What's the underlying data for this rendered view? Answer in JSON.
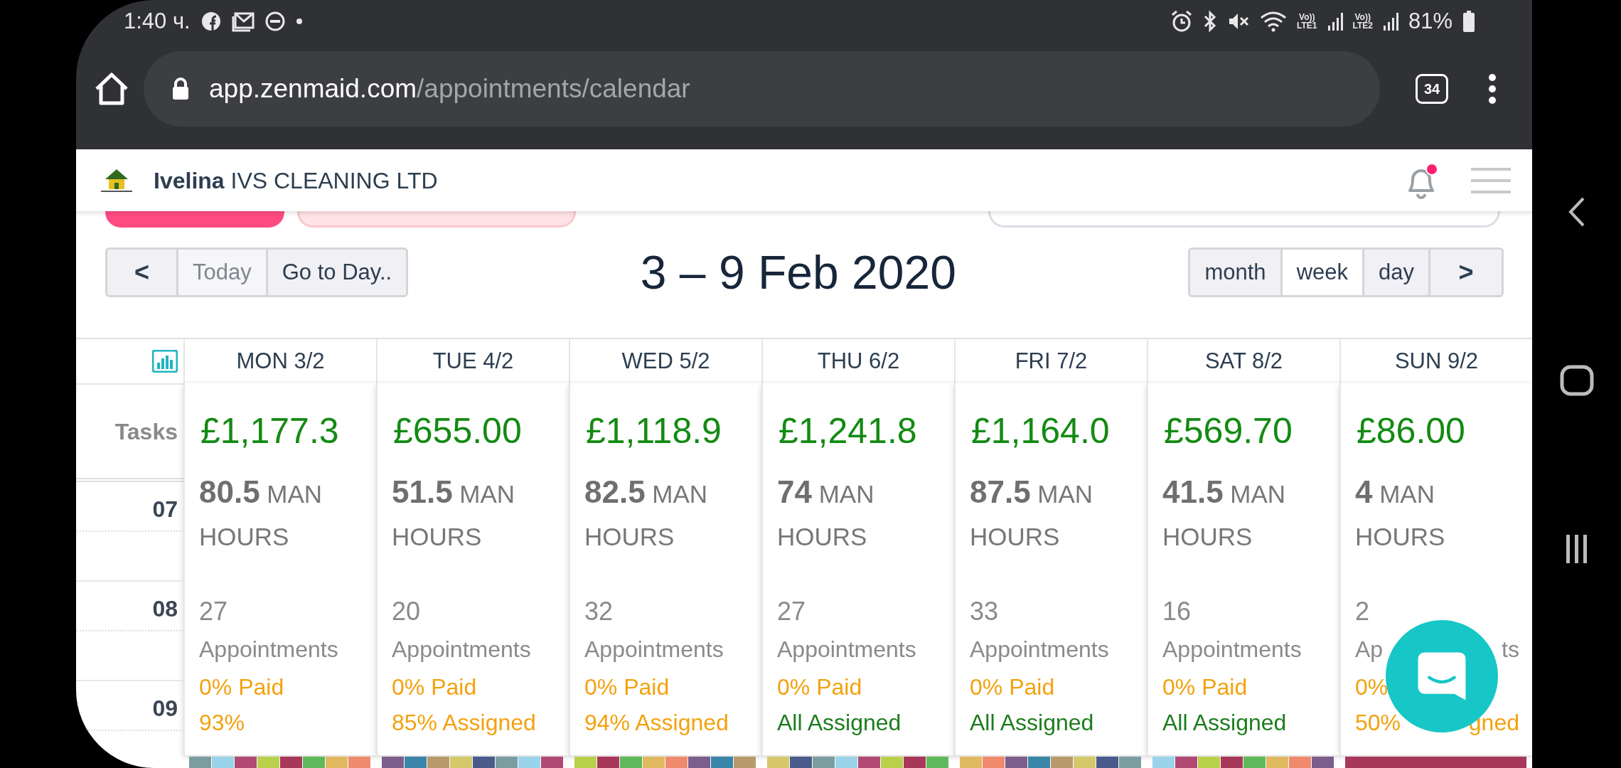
{
  "status_bar": {
    "time": "1:40 ч.",
    "networks": [
      {
        "top": "Vo))",
        "bottom": "LTE1"
      },
      {
        "top": "Vo))",
        "bottom": "LTE2"
      }
    ],
    "battery": "81%"
  },
  "browser": {
    "url_host": "app.zenmaid.com",
    "url_path": "/appointments/calendar",
    "tab_count": "34"
  },
  "app_header": {
    "title": "**Ivelina** IVS CLEANING LTD",
    "notification": true
  },
  "toolbar": {
    "nav_buttons": [
      {
        "label": "<",
        "disabled": false
      },
      {
        "label": "Today",
        "disabled": true
      },
      {
        "label": "Go to Day..",
        "disabled": false
      }
    ],
    "range_title": "3 – 9 Feb 2020",
    "views": [
      {
        "label": "month",
        "selected": false
      },
      {
        "label": "week",
        "selected": true
      },
      {
        "label": "day",
        "selected": false
      }
    ],
    "next": ">"
  },
  "calendar": {
    "row_header": "Tasks",
    "hours": [
      "07",
      "08",
      "09"
    ],
    "days": [
      {
        "label": "MON 3/2",
        "amount": "£1,177.3",
        "man_hours": "80.5",
        "unit": "MAN HOURS",
        "appointments": "27",
        "appointments_label": "Appointments",
        "paid": "0% Paid",
        "assigned": "93%",
        "fully_assigned": false
      },
      {
        "label": "TUE 4/2",
        "amount": "£655.00",
        "man_hours": "51.5",
        "unit": "MAN HOURS",
        "appointments": "20",
        "appointments_label": "Appointments",
        "paid": "0% Paid",
        "assigned": "85% Assigned",
        "fully_assigned": false
      },
      {
        "label": "WED 5/2",
        "amount": "£1,118.9",
        "man_hours": "82.5",
        "unit": "MAN HOURS",
        "appointments": "32",
        "appointments_label": "Appointments",
        "paid": "0% Paid",
        "assigned": "94% Assigned",
        "fully_assigned": false
      },
      {
        "label": "THU 6/2",
        "amount": "£1,241.8",
        "man_hours": "74",
        "unit": "MAN HOURS",
        "appointments": "27",
        "appointments_label": "Appointments",
        "paid": "0% Paid",
        "assigned": "All Assigned",
        "fully_assigned": true
      },
      {
        "label": "FRI 7/2",
        "amount": "£1,164.0",
        "man_hours": "87.5",
        "unit": "MAN HOURS",
        "appointments": "33",
        "appointments_label": "Appointments",
        "paid": "0% Paid",
        "assigned": "All Assigned",
        "fully_assigned": true
      },
      {
        "label": "SAT 8/2",
        "amount": "£569.70",
        "man_hours": "41.5",
        "unit": "MAN HOURS",
        "appointments": "16",
        "appointments_label": "Appointments",
        "paid": "0% Paid",
        "assigned": "All Assigned",
        "fully_assigned": true
      },
      {
        "label": "SUN 9/2",
        "amount": "£86.00",
        "man_hours": "4",
        "unit": "MAN HOURS",
        "appointments": "2",
        "appointments_label": "Ap",
        "appointments_label_tail": "ts",
        "paid": "0%",
        "assigned": "50%",
        "assigned_tail": "gned",
        "fully_assigned": false
      }
    ]
  }
}
